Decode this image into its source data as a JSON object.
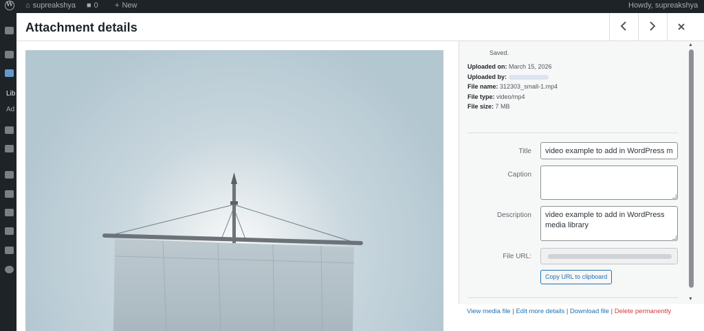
{
  "admin_bar": {
    "site_name": "supreakshya",
    "comments_count": "0",
    "new_label": "New",
    "howdy": "Howdy, supreakshya"
  },
  "sidebar": {
    "items": [
      {
        "label": "Lib"
      },
      {
        "label": "Ad"
      }
    ]
  },
  "modal": {
    "title": "Attachment details",
    "prev_label": "‹",
    "next_label": "›",
    "close_label": "×"
  },
  "details": {
    "status": "Saved.",
    "uploaded_on_label": "Uploaded on:",
    "uploaded_on": "March 15, 2026",
    "uploaded_by_label": "Uploaded by:",
    "file_name_label": "File name:",
    "file_name": "312303_small-1.mp4",
    "file_type_label": "File type:",
    "file_type": "video/mp4",
    "file_size_label": "File size:",
    "file_size": "7 MB",
    "fields": {
      "title_label": "Title",
      "title_value": "video example to add in WordPress m",
      "caption_label": "Caption",
      "caption_value": "",
      "description_label": "Description",
      "description_value": "video example to add in WordPress media library",
      "file_url_label": "File URL:"
    },
    "copy_button": "Copy URL to clipboard",
    "links": {
      "view": "View media file",
      "edit": "Edit more details",
      "download": "Download file",
      "delete": "Delete permanently",
      "separator": "|"
    }
  },
  "colors": {
    "accent": "#2271b1",
    "danger": "#d63638",
    "admin_bar": "#1d2327"
  }
}
